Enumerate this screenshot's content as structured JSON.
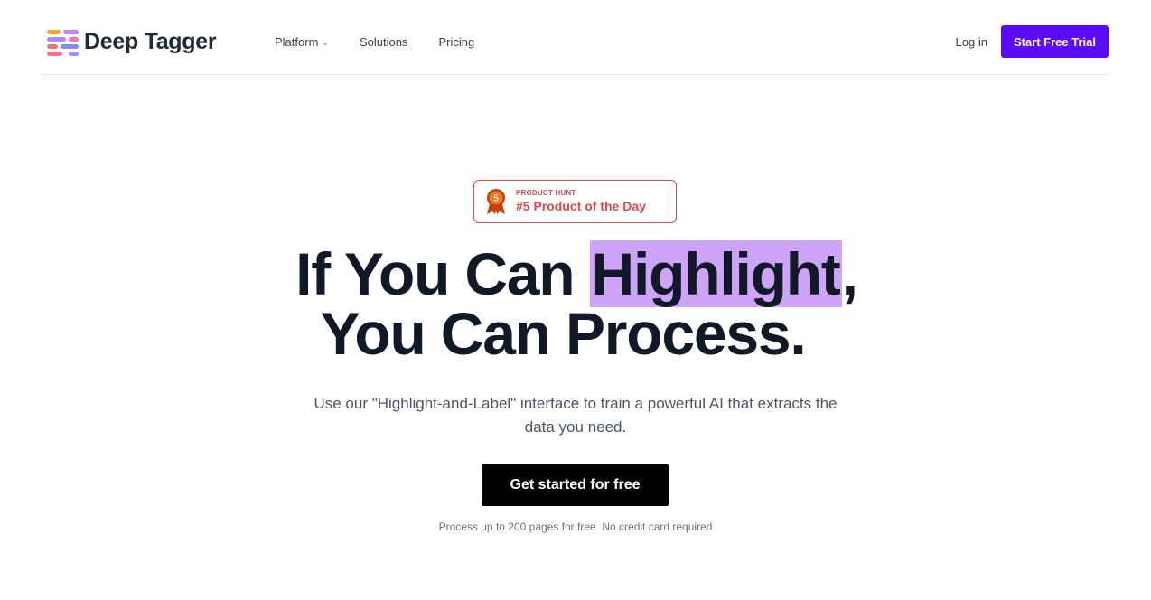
{
  "brand": {
    "name": "Deep Tagger",
    "icon": "stacked-bars-logo-icon",
    "accent": "#5b0cf6"
  },
  "nav": {
    "items": [
      {
        "label": "Platform",
        "has_dropdown": true,
        "icon": "chevron-down-icon"
      },
      {
        "label": "Solutions",
        "has_dropdown": false
      },
      {
        "label": "Pricing",
        "has_dropdown": false
      }
    ],
    "login_label": "Log in",
    "cta_label": "Start Free Trial"
  },
  "badge": {
    "rank": "5",
    "kicker": "PRODUCT HUNT",
    "title": "#5 Product of the Day",
    "icon": "medal-icon",
    "color": "#e0464a"
  },
  "hero": {
    "line1_before": "If You Can ",
    "line1_highlight": "Highlight",
    "line1_after": ",",
    "line2": "You Can Process.",
    "highlight_color": "#cda4f8",
    "subtitle": "Use our \"Highlight-and-Label\" interface to train a powerful AI that extracts the data you need.",
    "button_label": "Get started for free",
    "note": "Process up to 200 pages for free. No credit card required"
  }
}
